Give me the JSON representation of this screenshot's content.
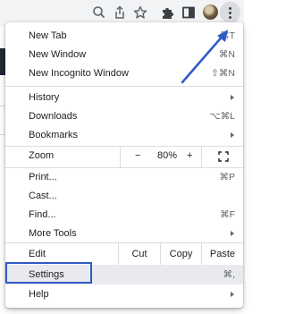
{
  "toolbar": {
    "icons": [
      "zoom-icon",
      "share-icon",
      "star-icon",
      "extensions-icon",
      "side-panel-icon",
      "profile-avatar",
      "more-menu-icon"
    ]
  },
  "menu": {
    "new_tab": {
      "label": "New Tab",
      "shortcut": "⌘T"
    },
    "new_window": {
      "label": "New Window",
      "shortcut": "⌘N"
    },
    "new_incognito": {
      "label": "New Incognito Window",
      "shortcut": "⇧⌘N"
    },
    "history": {
      "label": "History"
    },
    "downloads": {
      "label": "Downloads",
      "shortcut": "⌥⌘L"
    },
    "bookmarks": {
      "label": "Bookmarks"
    },
    "zoom": {
      "label": "Zoom",
      "minus": "−",
      "level": "80%",
      "plus": "+"
    },
    "print": {
      "label": "Print...",
      "shortcut": "⌘P"
    },
    "cast": {
      "label": "Cast..."
    },
    "find": {
      "label": "Find...",
      "shortcut": "⌘F"
    },
    "more_tools": {
      "label": "More Tools"
    },
    "edit": {
      "label": "Edit",
      "cut": "Cut",
      "copy": "Copy",
      "paste": "Paste"
    },
    "settings": {
      "label": "Settings",
      "shortcut": "⌘,"
    },
    "help": {
      "label": "Help"
    }
  },
  "annotation": {
    "color": "#2f5ac6"
  }
}
